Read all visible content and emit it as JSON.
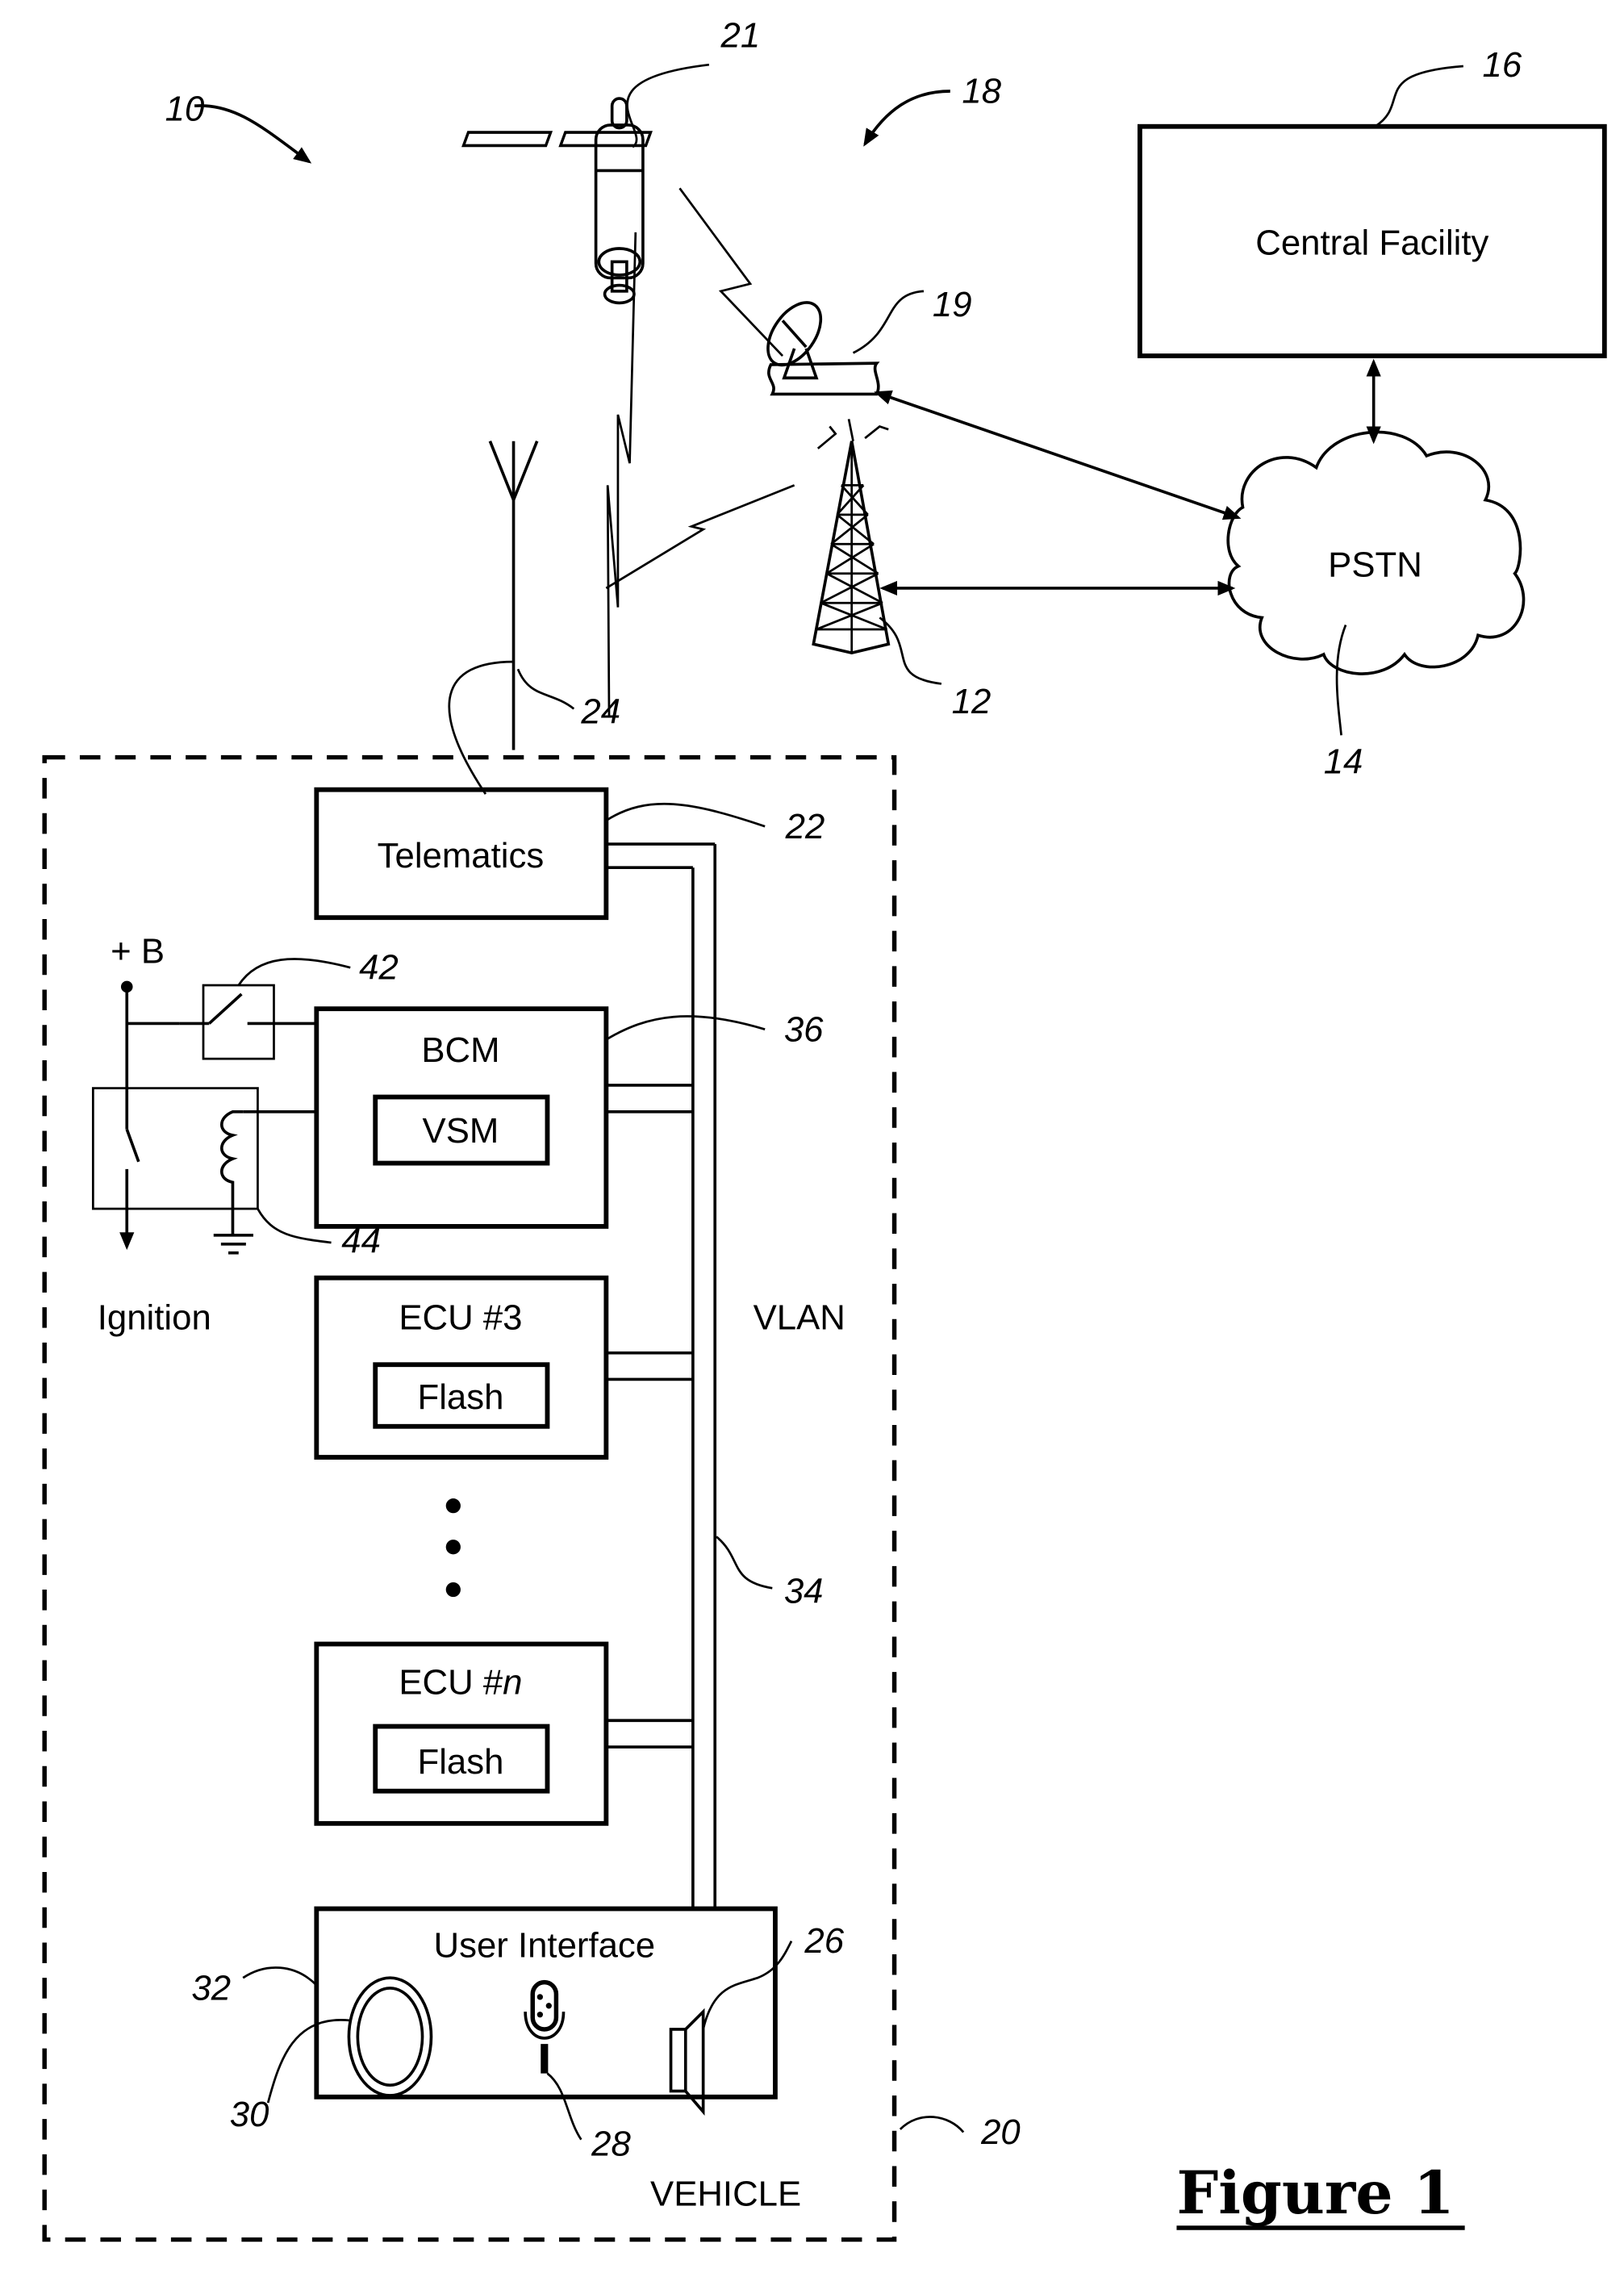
{
  "figure": {
    "title": "Figure 1",
    "colors": {
      "ink": "#000000",
      "paper": "#ffffff"
    }
  },
  "nodes": {
    "central_facility": {
      "label": "Central Facility",
      "ref": "16"
    },
    "pstn": {
      "label": "PSTN",
      "ref": "14"
    },
    "satellite": {
      "ref": "21"
    },
    "ground_station": {
      "ref": "19"
    },
    "cell_tower": {
      "ref": "12"
    },
    "antenna": {
      "ref": "24"
    },
    "telematics": {
      "label": "Telematics",
      "ref": "22"
    },
    "bcm": {
      "label": "BCM",
      "ref": "36"
    },
    "vsm": {
      "label": "VSM"
    },
    "ecu3": {
      "label": "ECU #3",
      "flash_label": "Flash"
    },
    "ecun": {
      "label_prefix": "ECU #",
      "label_suffix": "n",
      "flash_label": "Flash"
    },
    "user_interface": {
      "label": "User Interface",
      "ref": "32"
    },
    "speaker": {
      "ref": "26"
    },
    "microphone": {
      "ref": "28"
    },
    "button": {
      "ref": "30"
    },
    "vlan_bus": {
      "label": "VLAN",
      "ref": "34"
    },
    "vehicle": {
      "label": "VEHICLE",
      "ref": "20"
    },
    "power": {
      "label": "+ B"
    },
    "ignition": {
      "label": "Ignition"
    },
    "switch": {
      "ref": "42"
    },
    "relay": {
      "ref": "44"
    }
  },
  "system_refs": {
    "system": "10",
    "wireless": "18"
  }
}
